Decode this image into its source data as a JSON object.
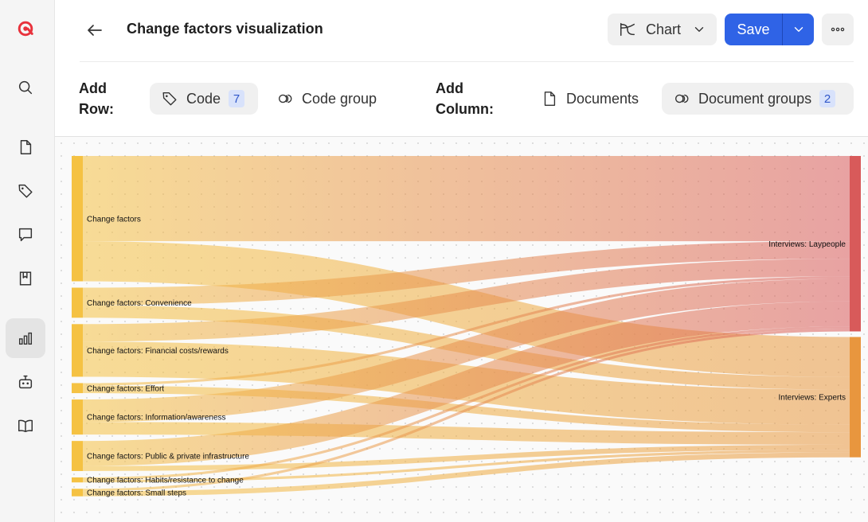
{
  "window": {
    "title": "Change factors visualization"
  },
  "toolbar": {
    "chart_type_label": "Chart",
    "save_label": "Save"
  },
  "config": {
    "add_row_label": "Add Row:",
    "add_column_label": "Add Column:",
    "row_options": [
      {
        "label": "Code",
        "count": "7",
        "active": true
      },
      {
        "label": "Code group",
        "count": "",
        "active": false
      }
    ],
    "column_options": [
      {
        "label": "Documents",
        "count": "",
        "active": false
      },
      {
        "label": "Document groups",
        "count": "2",
        "active": true
      }
    ]
  },
  "sidebar": {
    "items": [
      {
        "icon": "logo-icon"
      },
      {
        "icon": "search-icon"
      },
      {
        "icon": "document-icon"
      },
      {
        "icon": "tag-icon"
      },
      {
        "icon": "comment-icon"
      },
      {
        "icon": "bookmark-icon"
      },
      {
        "icon": "bar-chart-icon",
        "active": true
      },
      {
        "icon": "robot-icon"
      },
      {
        "icon": "book-icon"
      }
    ]
  },
  "colors": {
    "accent": "#2f63e6",
    "left_node": "#f5c243",
    "laypeople_node": "#d85a5a",
    "experts_node": "#e8963e"
  },
  "chart_data": {
    "type": "sankey",
    "sources": [
      "Change factors",
      "Change factors: Convenience",
      "Change factors: Financial costs/rewards",
      "Change factors: Effort",
      "Change factors: Information/awareness",
      "Change factors: Public & private infrastructure",
      "Change factors: Habits/resistance to change",
      "Change factors: Small steps"
    ],
    "targets": [
      "Interviews: Laypeople",
      "Interviews: Experts"
    ],
    "links": [
      {
        "source": 0,
        "target": 0,
        "value": 34
      },
      {
        "source": 0,
        "target": 1,
        "value": 16
      },
      {
        "source": 1,
        "target": 0,
        "value": 7
      },
      {
        "source": 1,
        "target": 1,
        "value": 5
      },
      {
        "source": 2,
        "target": 0,
        "value": 7
      },
      {
        "source": 2,
        "target": 1,
        "value": 14
      },
      {
        "source": 3,
        "target": 0,
        "value": 1
      },
      {
        "source": 3,
        "target": 1,
        "value": 3
      },
      {
        "source": 4,
        "target": 0,
        "value": 9
      },
      {
        "source": 4,
        "target": 1,
        "value": 5
      },
      {
        "source": 5,
        "target": 0,
        "value": 10
      },
      {
        "source": 5,
        "target": 1,
        "value": 2
      },
      {
        "source": 6,
        "target": 0,
        "value": 1
      },
      {
        "source": 6,
        "target": 1,
        "value": 1
      },
      {
        "source": 7,
        "target": 0,
        "value": 1
      },
      {
        "source": 7,
        "target": 1,
        "value": 2
      }
    ]
  }
}
